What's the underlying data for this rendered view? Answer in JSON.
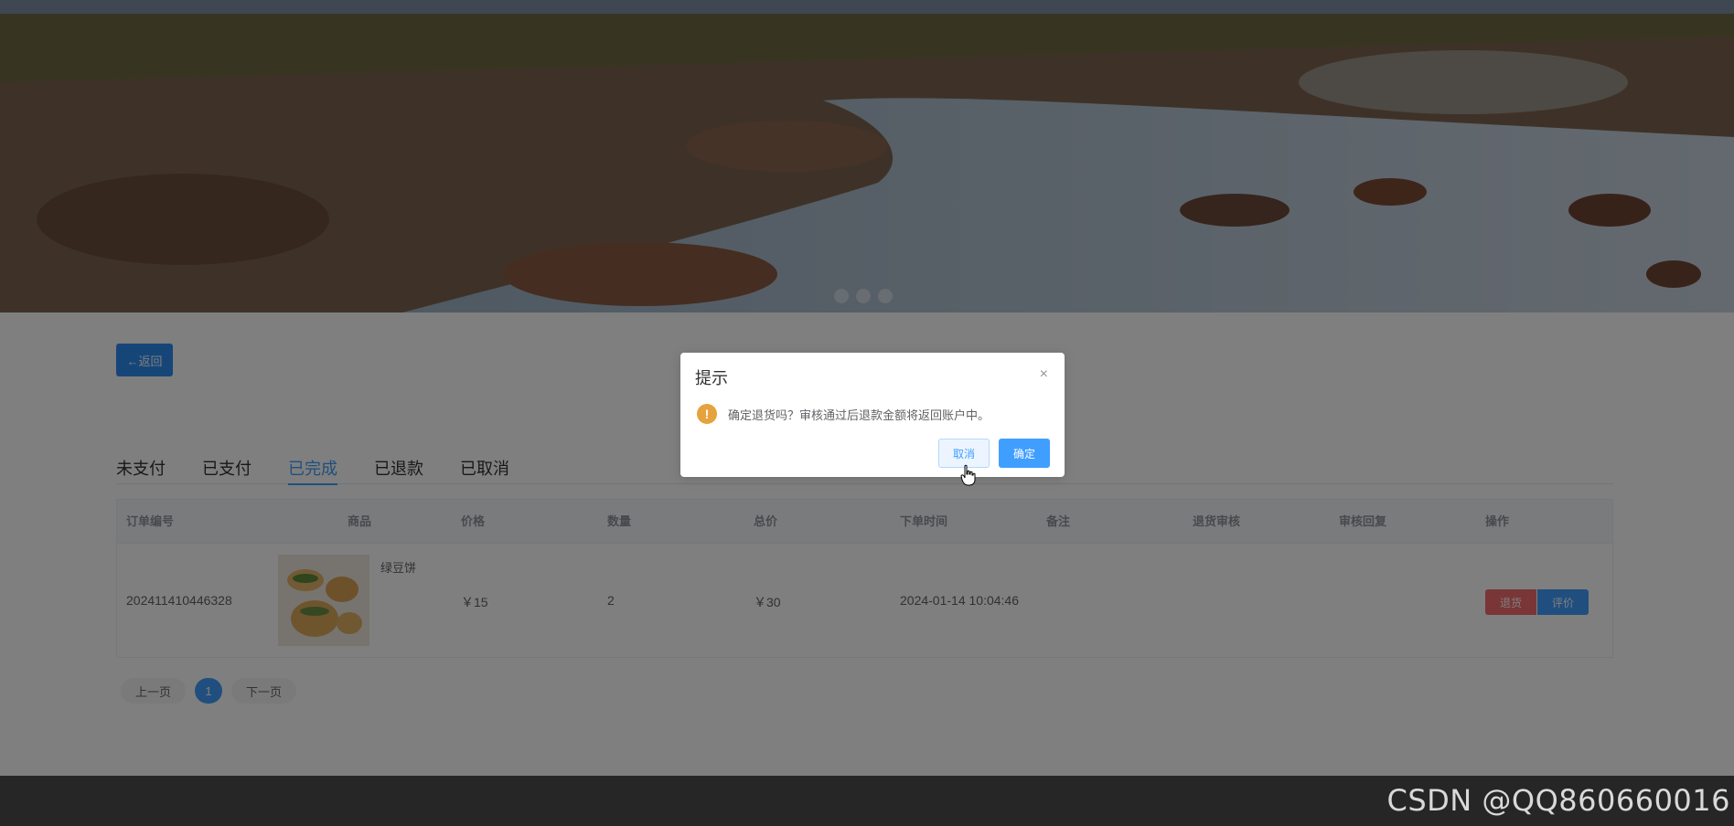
{
  "nav": {
    "back_label": "←返回"
  },
  "tabs": [
    {
      "label": "未支付"
    },
    {
      "label": "已支付"
    },
    {
      "label": "已完成"
    },
    {
      "label": "已退款"
    },
    {
      "label": "已取消"
    }
  ],
  "table": {
    "headers": [
      "订单编号",
      "商品",
      "价格",
      "数量",
      "总价",
      "下单时间",
      "备注",
      "退货审核",
      "审核回复",
      "操作"
    ],
    "rows": [
      {
        "order_no": "202411410446328",
        "product": "绿豆饼",
        "price": "￥15",
        "quantity": "2",
        "total": "￥30",
        "order_time": "2024-01-14 10:04:46",
        "remark": "",
        "refund_review": "",
        "review_reply": "",
        "actions": {
          "refund": "退货",
          "review": "评价"
        }
      }
    ]
  },
  "pagination": {
    "prev": "上一页",
    "current": "1",
    "next": "下一页"
  },
  "dialog": {
    "title": "提示",
    "message": "确定退货吗？审核通过后退款金额将返回账户中。",
    "cancel": "取消",
    "confirm": "确定",
    "close_icon": "×",
    "warn_icon": "!"
  },
  "watermark": "CSDN @QQ860660016",
  "colors": {
    "primary": "#409eff",
    "danger": "#f56c6c",
    "warning": "#e6a23c",
    "back_button": "#2d8cf0"
  }
}
